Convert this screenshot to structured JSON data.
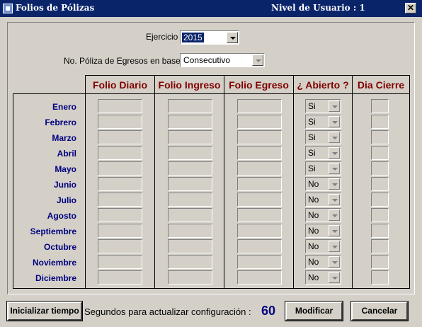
{
  "window": {
    "title": "Folios de Pólizas",
    "user_level": "Nivel de Usuario : 1",
    "close_glyph": "✕"
  },
  "form": {
    "ejercicio_label": "Ejercicio :",
    "ejercicio_value": "2015",
    "egresos_label": "No. Póliza de Egresos en base a :",
    "egresos_value": "Consecutivo"
  },
  "table": {
    "headers": [
      "Folio Diario",
      "Folio Ingreso",
      "Folio Egreso",
      "¿ Abierto ?",
      "Dia Cierre"
    ],
    "rows": [
      {
        "month": "Enero",
        "abierto": "Si"
      },
      {
        "month": "Febrero",
        "abierto": "Si"
      },
      {
        "month": "Marzo",
        "abierto": "Si"
      },
      {
        "month": "Abril",
        "abierto": "Si"
      },
      {
        "month": "Mayo",
        "abierto": "Si"
      },
      {
        "month": "Junio",
        "abierto": "No"
      },
      {
        "month": "Julio",
        "abierto": "No"
      },
      {
        "month": "Agosto",
        "abierto": "No"
      },
      {
        "month": "Septiembre",
        "abierto": "No"
      },
      {
        "month": "Octubre",
        "abierto": "No"
      },
      {
        "month": "Noviembre",
        "abierto": "No"
      },
      {
        "month": "Diciembre",
        "abierto": "No"
      }
    ]
  },
  "footer": {
    "reset_button": "Inicializar tiempo",
    "refresh_label": "Segundos para actualizar configuración :",
    "refresh_seconds": "60",
    "modify_button": "Modificar",
    "cancel_button": "Cancelar"
  },
  "colors": {
    "titlebar": "#0a246a",
    "header_text": "#800000",
    "month_text": "#000080",
    "window_bg": "#d4d0c8"
  }
}
